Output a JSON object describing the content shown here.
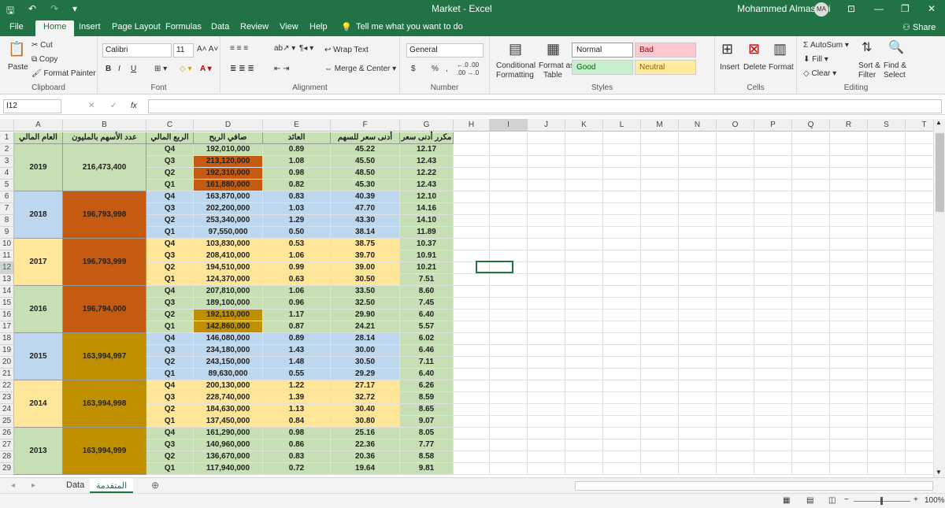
{
  "window": {
    "title": "Market  -  Excel",
    "user": "Mohammed Almasseri",
    "user_initials": "MA"
  },
  "tabs": [
    "File",
    "Home",
    "Insert",
    "Page Layout",
    "Formulas",
    "Data",
    "Review",
    "View",
    "Help"
  ],
  "tell_me": "Tell me what you want to do",
  "share": "Share",
  "clipboard": {
    "paste": "Paste",
    "cut": "Cut",
    "copy": "Copy",
    "format_painter": "Format Painter",
    "label": "Clipboard"
  },
  "font": {
    "name": "Calibri",
    "size": "11",
    "label": "Font",
    "bold": "B",
    "italic": "I",
    "underline": "U"
  },
  "alignment": {
    "wrap": "Wrap Text",
    "merge": "Merge & Center",
    "label": "Alignment"
  },
  "number": {
    "format": "General",
    "currency": "$",
    "percent": "%",
    "comma": ",",
    "inc_decimal": "←.0 .00",
    "dec_decimal": ".00 →.0",
    "label": "Number"
  },
  "styles": {
    "conditional": "Conditional",
    "conditional2": "Formatting",
    "format_as": "Format as",
    "table": "Table",
    "normal": "Normal",
    "bad": "Bad",
    "good": "Good",
    "neutral": "Neutral",
    "label": "Styles"
  },
  "cells": {
    "insert": "Insert",
    "delete": "Delete",
    "format": "Format",
    "label": "Cells"
  },
  "editing": {
    "autosum": "AutoSum",
    "fill": "Fill",
    "clear": "Clear",
    "sort": "Sort &",
    "sort2": "Filter",
    "find": "Find &",
    "find2": "Select",
    "label": "Editing"
  },
  "namebox": "I12",
  "fx": "fx",
  "columns": [
    "A",
    "B",
    "C",
    "D",
    "E",
    "F",
    "G",
    "H",
    "I",
    "J",
    "K",
    "L",
    "M",
    "N",
    "O",
    "P",
    "Q",
    "R",
    "S",
    "T"
  ],
  "headers": [
    "العام المالي",
    "عدد الأسهم بالمليون",
    "الربع المالي",
    "صافي الربح",
    "العائد",
    "أدنى سعر للسهم",
    "مكرر أدنى سعر"
  ],
  "rows": [
    {
      "q": "Q4",
      "profit": "192,010,000",
      "ret": "0.89",
      "low": "45.22",
      "pe": "12.17"
    },
    {
      "q": "Q3",
      "profit": "213,120,000",
      "ret": "1.08",
      "low": "45.50",
      "pe": "12.43"
    },
    {
      "q": "Q2",
      "profit": "192,310,000",
      "ret": "0.98",
      "low": "48.50",
      "pe": "12.22"
    },
    {
      "q": "Q1",
      "profit": "161,880,000",
      "ret": "0.82",
      "low": "45.30",
      "pe": "12.43"
    },
    {
      "q": "Q4",
      "profit": "163,870,000",
      "ret": "0.83",
      "low": "40.39",
      "pe": "12.10"
    },
    {
      "q": "Q3",
      "profit": "202,200,000",
      "ret": "1.03",
      "low": "47.70",
      "pe": "14.16"
    },
    {
      "q": "Q2",
      "profit": "253,340,000",
      "ret": "1.29",
      "low": "43.30",
      "pe": "14.10"
    },
    {
      "q": "Q1",
      "profit": "97,550,000",
      "ret": "0.50",
      "low": "38.14",
      "pe": "11.89"
    },
    {
      "q": "Q4",
      "profit": "103,830,000",
      "ret": "0.53",
      "low": "38.75",
      "pe": "10.37"
    },
    {
      "q": "Q3",
      "profit": "208,410,000",
      "ret": "1.06",
      "low": "39.70",
      "pe": "10.91"
    },
    {
      "q": "Q2",
      "profit": "194,510,000",
      "ret": "0.99",
      "low": "39.00",
      "pe": "10.21"
    },
    {
      "q": "Q1",
      "profit": "124,370,000",
      "ret": "0.63",
      "low": "30.50",
      "pe": "7.51"
    },
    {
      "q": "Q4",
      "profit": "207,810,000",
      "ret": "1.06",
      "low": "33.50",
      "pe": "8.60"
    },
    {
      "q": "Q3",
      "profit": "189,100,000",
      "ret": "0.96",
      "low": "32.50",
      "pe": "7.45"
    },
    {
      "q": "Q2",
      "profit": "192,110,000",
      "ret": "1.17",
      "low": "29.90",
      "pe": "6.40"
    },
    {
      "q": "Q1",
      "profit": "142,860,000",
      "ret": "0.87",
      "low": "24.21",
      "pe": "5.57"
    },
    {
      "q": "Q4",
      "profit": "146,080,000",
      "ret": "0.89",
      "low": "28.14",
      "pe": "6.02"
    },
    {
      "q": "Q3",
      "profit": "234,180,000",
      "ret": "1.43",
      "low": "30.00",
      "pe": "6.46"
    },
    {
      "q": "Q2",
      "profit": "243,150,000",
      "ret": "1.48",
      "low": "30.50",
      "pe": "7.11"
    },
    {
      "q": "Q1",
      "profit": "89,630,000",
      "ret": "0.55",
      "low": "29.29",
      "pe": "6.40"
    },
    {
      "q": "Q4",
      "profit": "200,130,000",
      "ret": "1.22",
      "low": "27.17",
      "pe": "6.26"
    },
    {
      "q": "Q3",
      "profit": "228,740,000",
      "ret": "1.39",
      "low": "32.72",
      "pe": "8.59"
    },
    {
      "q": "Q2",
      "profit": "184,630,000",
      "ret": "1.13",
      "low": "30.40",
      "pe": "8.65"
    },
    {
      "q": "Q1",
      "profit": "137,450,000",
      "ret": "0.84",
      "low": "30.80",
      "pe": "9.07"
    },
    {
      "q": "Q4",
      "profit": "161,290,000",
      "ret": "0.98",
      "low": "25.16",
      "pe": "8.05"
    },
    {
      "q": "Q3",
      "profit": "140,960,000",
      "ret": "0.86",
      "low": "22.36",
      "pe": "7.77"
    },
    {
      "q": "Q2",
      "profit": "136,670,000",
      "ret": "0.83",
      "low": "20.36",
      "pe": "8.58"
    },
    {
      "q": "Q1",
      "profit": "117,940,000",
      "ret": "0.72",
      "low": "19.64",
      "pe": "9.81"
    }
  ],
  "years": [
    {
      "year": "2019",
      "shares": "216,473,400"
    },
    {
      "year": "2018",
      "shares": "196,793,998"
    },
    {
      "year": "2017",
      "shares": "196,793,999"
    },
    {
      "year": "2016",
      "shares": "196,794,000"
    },
    {
      "year": "2015",
      "shares": "163,994,997"
    },
    {
      "year": "2014",
      "shares": "163,994,998"
    },
    {
      "year": "2013",
      "shares": "163,994,999"
    }
  ],
  "colors": {
    "green": "#c6e0b4",
    "blue": "#bdd7ee",
    "yellow": "#ffe699",
    "orange": "#c55a11",
    "gold": "#bf8f00",
    "excel": "#217346"
  },
  "sheets": [
    "Data",
    "المتقدمة"
  ],
  "zoom": "100%"
}
